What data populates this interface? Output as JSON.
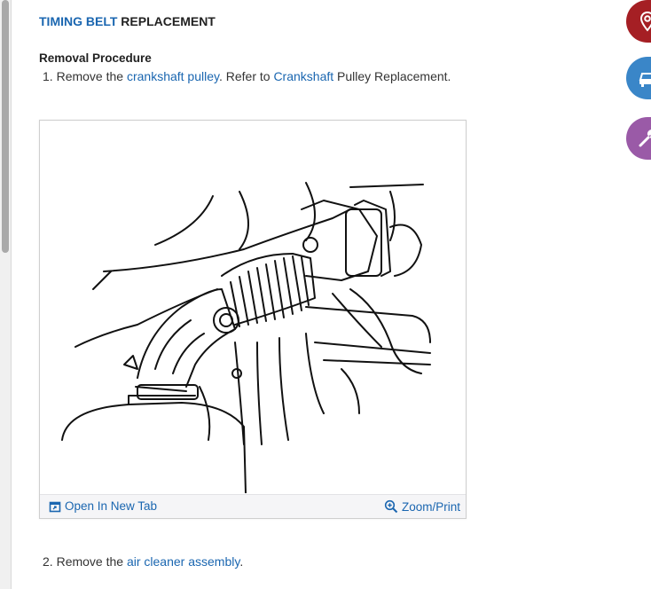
{
  "article": {
    "title_highlight": "TIMING BELT",
    "title_rest": " REPLACEMENT",
    "section_title": "Removal Procedure",
    "step1": {
      "number": "1.",
      "text_before": "Remove the ",
      "link1": "crankshaft pulley",
      "text_mid": ". Refer to ",
      "link2": "Crankshaft",
      "text_after": " Pulley Replacement."
    },
    "step2": {
      "number": "2.",
      "text_before": "Remove the ",
      "link": "air cleaner assembly",
      "text_after": "."
    }
  },
  "figure": {
    "open_tab_label": "Open In New Tab",
    "zoom_label": "Zoom/Print",
    "open_tab_icon": "open-in-new-tab-icon",
    "zoom_icon": "zoom-in-icon"
  },
  "side_actions": [
    {
      "icon": "location-pin-icon",
      "color": "#a51f24"
    },
    {
      "icon": "vehicle-icon",
      "color": "#3a86c8"
    },
    {
      "icon": "wrench-icon",
      "color": "#9a5aa7"
    }
  ]
}
